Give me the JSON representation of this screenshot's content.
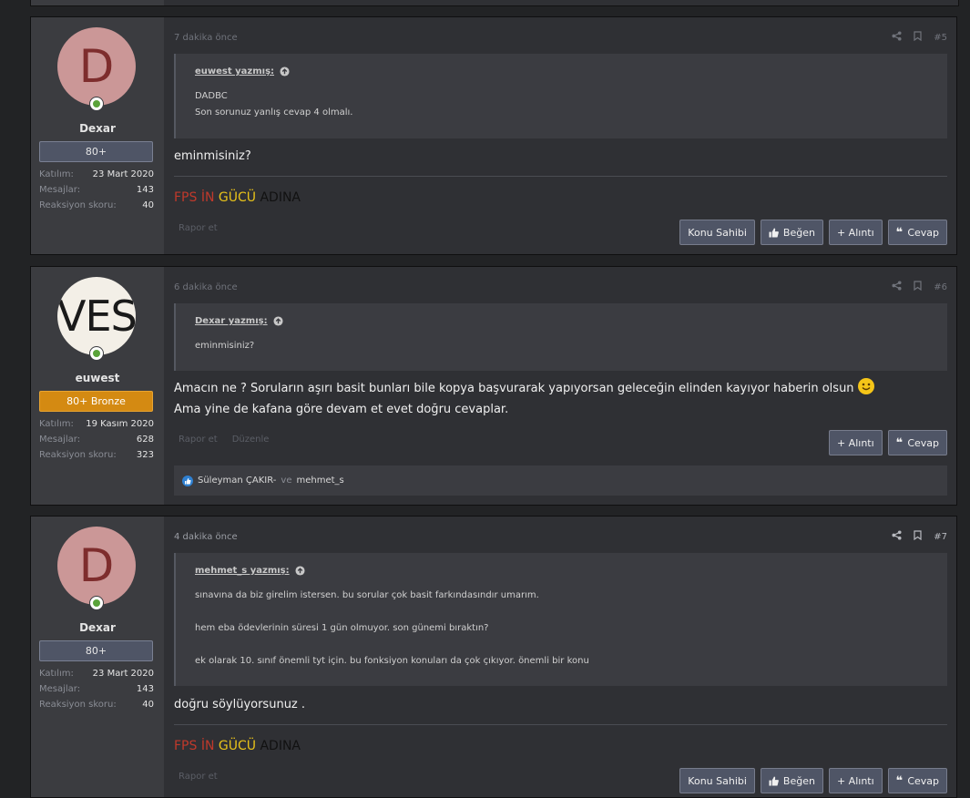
{
  "posts": [
    {
      "author": "Dexar",
      "avatar_letter": "D",
      "user_title": "80+",
      "stats": [
        {
          "label": "Katılım:",
          "value": "23 Mart 2020"
        },
        {
          "label": "Mesajlar:",
          "value": "143"
        },
        {
          "label": "Reaksiyon skoru:",
          "value": "40"
        }
      ],
      "date": "7 dakika önce",
      "post_number": "#5",
      "quote": {
        "author": "euwest yazmış:",
        "lines": [
          "DADBC",
          "Son sorunuz yanlış cevap 4 olmalı."
        ]
      },
      "body": [
        "eminmisiniz?"
      ],
      "signature": {
        "red": "FPS İN",
        "yellow": "GÜCÜ",
        "black": "ADINA"
      },
      "links": [
        "Rapor et"
      ],
      "buttons": [
        "Konu Sahibi",
        "Beğen",
        "+ Alıntı",
        "Cevap"
      ]
    },
    {
      "author": "euwest",
      "avatar_letter": "VES",
      "user_title": "80+ Bronze",
      "stats": [
        {
          "label": "Katılım:",
          "value": "19 Kasım 2020"
        },
        {
          "label": "Mesajlar:",
          "value": "628"
        },
        {
          "label": "Reaksiyon skoru:",
          "value": "323"
        }
      ],
      "date": "6 dakika önce",
      "post_number": "#6",
      "quote": {
        "author": "Dexar yazmış:",
        "lines": [
          "eminmisiniz?"
        ]
      },
      "body": [
        "Amacın ne ? Soruların aşırı basit bunları bile kopya başvurarak yapıyorsan geleceğin elinden kayıyor haberin olsun",
        "Ama yine de kafana göre devam et evet doğru cevaplar."
      ],
      "links": [
        "Rapor et",
        "Düzenle"
      ],
      "buttons": [
        "+ Alıntı",
        "Cevap"
      ],
      "reactions": {
        "user1": "Süleyman ÇAKIR-",
        "and": "ve",
        "user2": "mehmet_s"
      }
    },
    {
      "author": "Dexar",
      "avatar_letter": "D",
      "user_title": "80+",
      "stats": [
        {
          "label": "Katılım:",
          "value": "23 Mart 2020"
        },
        {
          "label": "Mesajlar:",
          "value": "143"
        },
        {
          "label": "Reaksiyon skoru:",
          "value": "40"
        }
      ],
      "date": "4 dakika önce",
      "post_number": "#7",
      "quote": {
        "author": "mehmet_s yazmış:",
        "lines": [
          "sınavına da biz girelim istersen. bu sorular çok basit farkındasındır umarım.",
          "hem eba ödevlerinin süresi 1 gün olmuyor. son günemi bıraktın?",
          "ek olarak 10. sınıf önemli tyt için. bu fonksiyon konuları da çok çıkıyor. önemli bir konu"
        ]
      },
      "body": [
        "doğru söylüyorsunuz ."
      ],
      "signature": {
        "red": "FPS İN",
        "yellow": "GÜCÜ",
        "black": "ADINA"
      },
      "links": [
        "Rapor et"
      ],
      "buttons": [
        "Konu Sahibi",
        "Beğen",
        "+ Alıntı",
        "Cevap"
      ]
    }
  ],
  "colors": {
    "accent_bronze": "#d48a12",
    "online": "#5aa33a",
    "sig_red": "#c0392b",
    "sig_yellow": "#e8c21a"
  }
}
